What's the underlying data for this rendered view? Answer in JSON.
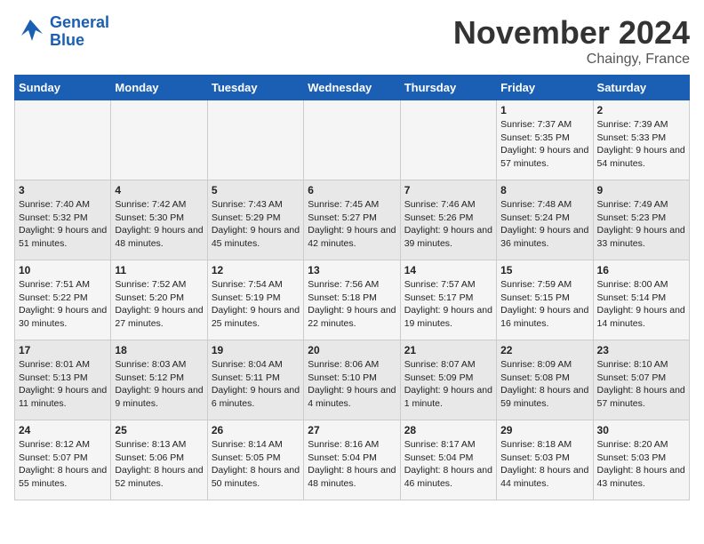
{
  "logo": {
    "line1": "General",
    "line2": "Blue"
  },
  "title": "November 2024",
  "location": "Chaingy, France",
  "days_of_week": [
    "Sunday",
    "Monday",
    "Tuesday",
    "Wednesday",
    "Thursday",
    "Friday",
    "Saturday"
  ],
  "weeks": [
    [
      {
        "day": "",
        "info": ""
      },
      {
        "day": "",
        "info": ""
      },
      {
        "day": "",
        "info": ""
      },
      {
        "day": "",
        "info": ""
      },
      {
        "day": "",
        "info": ""
      },
      {
        "day": "1",
        "info": "Sunrise: 7:37 AM\nSunset: 5:35 PM\nDaylight: 9 hours and 57 minutes."
      },
      {
        "day": "2",
        "info": "Sunrise: 7:39 AM\nSunset: 5:33 PM\nDaylight: 9 hours and 54 minutes."
      }
    ],
    [
      {
        "day": "3",
        "info": "Sunrise: 7:40 AM\nSunset: 5:32 PM\nDaylight: 9 hours and 51 minutes."
      },
      {
        "day": "4",
        "info": "Sunrise: 7:42 AM\nSunset: 5:30 PM\nDaylight: 9 hours and 48 minutes."
      },
      {
        "day": "5",
        "info": "Sunrise: 7:43 AM\nSunset: 5:29 PM\nDaylight: 9 hours and 45 minutes."
      },
      {
        "day": "6",
        "info": "Sunrise: 7:45 AM\nSunset: 5:27 PM\nDaylight: 9 hours and 42 minutes."
      },
      {
        "day": "7",
        "info": "Sunrise: 7:46 AM\nSunset: 5:26 PM\nDaylight: 9 hours and 39 minutes."
      },
      {
        "day": "8",
        "info": "Sunrise: 7:48 AM\nSunset: 5:24 PM\nDaylight: 9 hours and 36 minutes."
      },
      {
        "day": "9",
        "info": "Sunrise: 7:49 AM\nSunset: 5:23 PM\nDaylight: 9 hours and 33 minutes."
      }
    ],
    [
      {
        "day": "10",
        "info": "Sunrise: 7:51 AM\nSunset: 5:22 PM\nDaylight: 9 hours and 30 minutes."
      },
      {
        "day": "11",
        "info": "Sunrise: 7:52 AM\nSunset: 5:20 PM\nDaylight: 9 hours and 27 minutes."
      },
      {
        "day": "12",
        "info": "Sunrise: 7:54 AM\nSunset: 5:19 PM\nDaylight: 9 hours and 25 minutes."
      },
      {
        "day": "13",
        "info": "Sunrise: 7:56 AM\nSunset: 5:18 PM\nDaylight: 9 hours and 22 minutes."
      },
      {
        "day": "14",
        "info": "Sunrise: 7:57 AM\nSunset: 5:17 PM\nDaylight: 9 hours and 19 minutes."
      },
      {
        "day": "15",
        "info": "Sunrise: 7:59 AM\nSunset: 5:15 PM\nDaylight: 9 hours and 16 minutes."
      },
      {
        "day": "16",
        "info": "Sunrise: 8:00 AM\nSunset: 5:14 PM\nDaylight: 9 hours and 14 minutes."
      }
    ],
    [
      {
        "day": "17",
        "info": "Sunrise: 8:01 AM\nSunset: 5:13 PM\nDaylight: 9 hours and 11 minutes."
      },
      {
        "day": "18",
        "info": "Sunrise: 8:03 AM\nSunset: 5:12 PM\nDaylight: 9 hours and 9 minutes."
      },
      {
        "day": "19",
        "info": "Sunrise: 8:04 AM\nSunset: 5:11 PM\nDaylight: 9 hours and 6 minutes."
      },
      {
        "day": "20",
        "info": "Sunrise: 8:06 AM\nSunset: 5:10 PM\nDaylight: 9 hours and 4 minutes."
      },
      {
        "day": "21",
        "info": "Sunrise: 8:07 AM\nSunset: 5:09 PM\nDaylight: 9 hours and 1 minute."
      },
      {
        "day": "22",
        "info": "Sunrise: 8:09 AM\nSunset: 5:08 PM\nDaylight: 8 hours and 59 minutes."
      },
      {
        "day": "23",
        "info": "Sunrise: 8:10 AM\nSunset: 5:07 PM\nDaylight: 8 hours and 57 minutes."
      }
    ],
    [
      {
        "day": "24",
        "info": "Sunrise: 8:12 AM\nSunset: 5:07 PM\nDaylight: 8 hours and 55 minutes."
      },
      {
        "day": "25",
        "info": "Sunrise: 8:13 AM\nSunset: 5:06 PM\nDaylight: 8 hours and 52 minutes."
      },
      {
        "day": "26",
        "info": "Sunrise: 8:14 AM\nSunset: 5:05 PM\nDaylight: 8 hours and 50 minutes."
      },
      {
        "day": "27",
        "info": "Sunrise: 8:16 AM\nSunset: 5:04 PM\nDaylight: 8 hours and 48 minutes."
      },
      {
        "day": "28",
        "info": "Sunrise: 8:17 AM\nSunset: 5:04 PM\nDaylight: 8 hours and 46 minutes."
      },
      {
        "day": "29",
        "info": "Sunrise: 8:18 AM\nSunset: 5:03 PM\nDaylight: 8 hours and 44 minutes."
      },
      {
        "day": "30",
        "info": "Sunrise: 8:20 AM\nSunset: 5:03 PM\nDaylight: 8 hours and 43 minutes."
      }
    ]
  ]
}
